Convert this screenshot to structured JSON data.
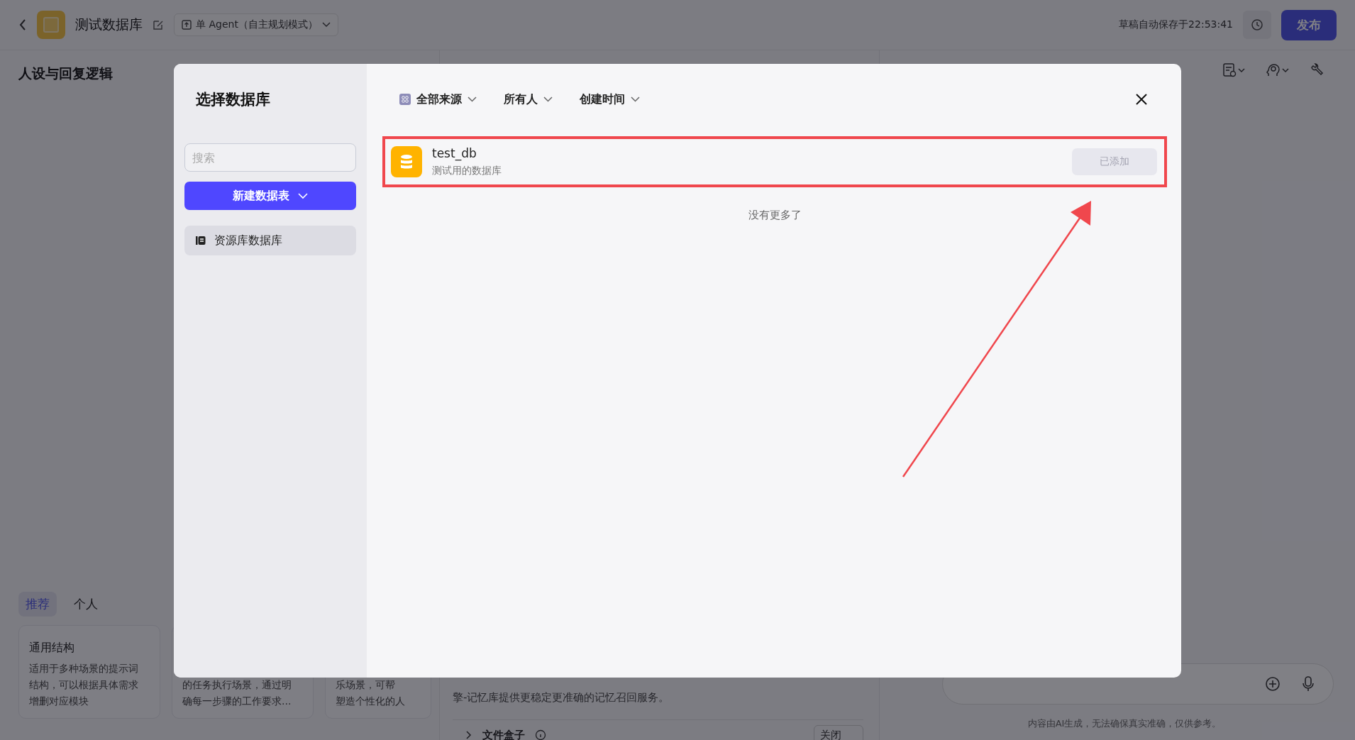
{
  "header": {
    "title": "测试数据库",
    "mode": "单 Agent（自主规划模式）",
    "autosave": "草稿自动保存于22:53:41",
    "publish": "发布"
  },
  "persona_panel": {
    "title": "人设与回复逻辑",
    "tabs": [
      {
        "label": "推荐",
        "selected": true
      },
      {
        "label": "个人",
        "selected": false
      }
    ],
    "templates": [
      {
        "title": "通用结构",
        "lines": [
          "适用于多种场景的提示词",
          "结构，可以根据具体需求",
          "增删对应模块"
        ]
      },
      {
        "lines": [
          "的任务执行场景，通过明",
          "确每一步骤的工作要求…"
        ]
      },
      {
        "lines": [
          "乐场景，可帮",
          "塑造个性化的人"
        ]
      }
    ]
  },
  "skills_panel": {
    "memory_lines": [
      "擎-记忆库提供更稳定更准确的记忆召回服务。"
    ],
    "file_box": {
      "label": "文件盒子",
      "value": "关闭"
    }
  },
  "preview_panel": {
    "disclaimer": "内容由AI生成，无法确保真实准确，仅供参考。"
  },
  "dialog": {
    "title": "选择数据库",
    "search": {
      "placeholder": "搜索"
    },
    "new_button": "新建数据表",
    "nav": [
      {
        "label": "资源库数据库",
        "selected": true
      }
    ],
    "filters": [
      "全部来源",
      "所有人",
      "创建时间"
    ],
    "items": [
      {
        "name": "test_db",
        "description": "测试用的数据库",
        "action": "已添加",
        "disabled": true
      }
    ],
    "end_text": "没有更多了"
  }
}
